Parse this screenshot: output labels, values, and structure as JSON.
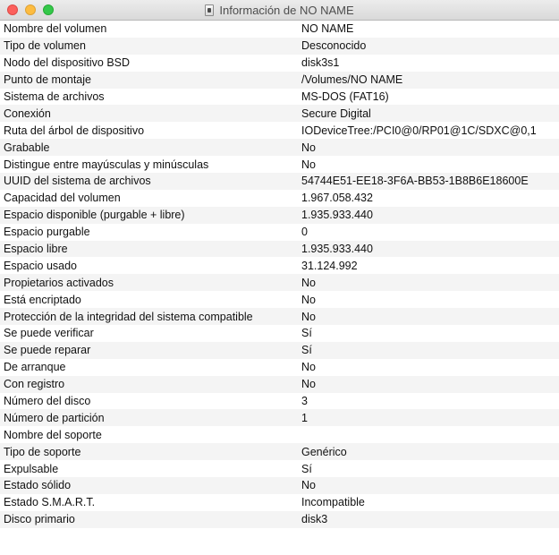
{
  "window": {
    "title": "Información de NO NAME"
  },
  "rows": [
    {
      "key": "Nombre del volumen",
      "value": "NO NAME"
    },
    {
      "key": "Tipo de volumen",
      "value": "Desconocido"
    },
    {
      "key": "Nodo del dispositivo BSD",
      "value": "disk3s1"
    },
    {
      "key": "Punto de montaje",
      "value": "/Volumes/NO NAME"
    },
    {
      "key": "Sistema de archivos",
      "value": "MS-DOS (FAT16)"
    },
    {
      "key": "Conexión",
      "value": "Secure Digital"
    },
    {
      "key": "Ruta del árbol de dispositivo",
      "value": "IODeviceTree:/PCI0@0/RP01@1C/SDXC@0,1"
    },
    {
      "key": "Grabable",
      "value": "No"
    },
    {
      "key": "Distingue entre mayúsculas y minúsculas",
      "value": "No"
    },
    {
      "key": "UUID del sistema de archivos",
      "value": "54744E51-EE18-3F6A-BB53-1B8B6E18600E"
    },
    {
      "key": "Capacidad del volumen",
      "value": "1.967.058.432"
    },
    {
      "key": "Espacio disponible (purgable + libre)",
      "value": "1.935.933.440"
    },
    {
      "key": "Espacio purgable",
      "value": "0"
    },
    {
      "key": "Espacio libre",
      "value": "1.935.933.440"
    },
    {
      "key": "Espacio usado",
      "value": "31.124.992"
    },
    {
      "key": "Propietarios activados",
      "value": "No"
    },
    {
      "key": "Está encriptado",
      "value": "No"
    },
    {
      "key": "Protección de la integridad del sistema compatible",
      "value": "No"
    },
    {
      "key": "Se puede verificar",
      "value": "Sí"
    },
    {
      "key": "Se puede reparar",
      "value": "Sí"
    },
    {
      "key": "De arranque",
      "value": "No"
    },
    {
      "key": "Con registro",
      "value": "No"
    },
    {
      "key": "Número del disco",
      "value": "3"
    },
    {
      "key": "Número de partición",
      "value": "1"
    },
    {
      "key": "Nombre del soporte",
      "value": ""
    },
    {
      "key": "Tipo de soporte",
      "value": "Genérico"
    },
    {
      "key": "Expulsable",
      "value": "Sí"
    },
    {
      "key": "Estado sólido",
      "value": "No"
    },
    {
      "key": "Estado S.M.A.R.T.",
      "value": "Incompatible"
    },
    {
      "key": "Disco primario",
      "value": "disk3"
    },
    {
      "key": "",
      "value": ""
    }
  ]
}
